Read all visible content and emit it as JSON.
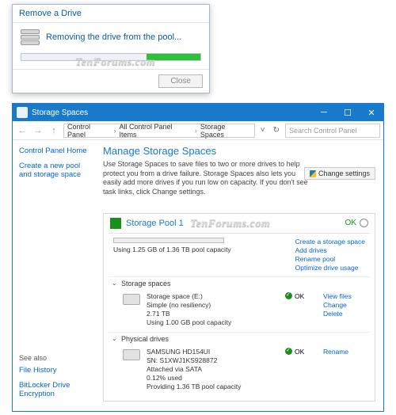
{
  "dialog": {
    "title": "Remove a Drive",
    "message": "Removing the drive from the pool...",
    "close_label": "Close"
  },
  "window": {
    "title": "Storage Spaces",
    "breadcrumb": [
      "Control Panel",
      "All Control Panel Items",
      "Storage Spaces"
    ],
    "search_placeholder": "Search Control Panel"
  },
  "sidebar": {
    "home": "Control Panel Home",
    "create": "Create a new pool and storage space",
    "see_also_label": "See also",
    "file_history": "File History",
    "bitlocker": "BitLocker Drive Encryption"
  },
  "main": {
    "heading": "Manage Storage Spaces",
    "description": "Use Storage Spaces to save files to two or more drives to help protect you from a drive failure. Storage Spaces also lets you easily add more drives if you run low on capacity. If you don't see task links, click Change settings.",
    "change_settings": "Change settings"
  },
  "pool": {
    "name": "Storage Pool 1",
    "status": "OK",
    "capacity": "Using 1.25 GB of 1.36 TB pool capacity",
    "actions": {
      "create": "Create a storage space",
      "add": "Add drives",
      "rename": "Rename pool",
      "optimize": "Optimize drive usage"
    },
    "spaces_header": "Storage spaces",
    "physical_header": "Physical drives",
    "space": {
      "name": "Storage space (E:)",
      "resiliency": "Simple (no resiliency)",
      "size": "2.71 TB",
      "usage": "Using 1.00 GB pool capacity",
      "status": "OK",
      "view": "View files",
      "change": "Change",
      "delete": "Delete"
    },
    "drive": {
      "name": "SAMSUNG HD154UI",
      "sn": "SN: S1XWJ1KS928872",
      "conn": "Attached via SATA",
      "used": "0.12% used",
      "providing": "Providing 1.36 TB pool capacity",
      "status": "OK",
      "rename": "Rename"
    }
  },
  "watermark": "TenForums.com"
}
